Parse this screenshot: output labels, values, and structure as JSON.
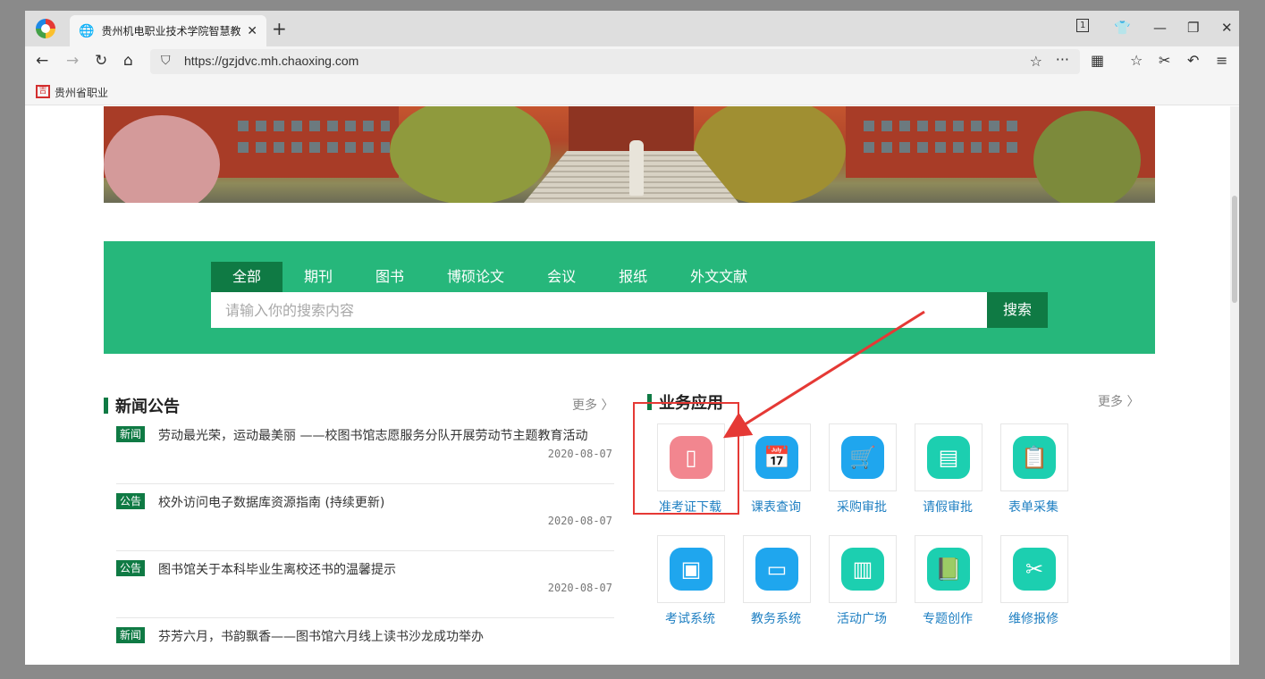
{
  "browser": {
    "tab_title": "贵州机电职业技术学院智慧教",
    "url": "https://gzjdvc.mh.chaoxing.com",
    "tab_count": "1",
    "bookmark": "贵州省职业"
  },
  "search": {
    "tabs": [
      "全部",
      "期刊",
      "图书",
      "博硕论文",
      "会议",
      "报纸",
      "外文文献"
    ],
    "placeholder": "请输入你的搜索内容",
    "button": "搜索"
  },
  "news": {
    "title": "新闻公告",
    "more": "更多 〉",
    "items": [
      {
        "badge": "新闻",
        "title": "劳动最光荣，运动最美丽 ——校图书馆志愿服务分队开展劳动节主题教育活动",
        "date": "2020-08-07"
      },
      {
        "badge": "公告",
        "title": "校外访问电子数据库资源指南 (持续更新)",
        "date": "2020-08-07"
      },
      {
        "badge": "公告",
        "title": "图书馆关于本科毕业生离校还书的温馨提示",
        "date": "2020-08-07"
      },
      {
        "badge": "新闻",
        "title": "芬芳六月，书韵飘香——图书馆六月线上读书沙龙成功举办",
        "date": ""
      }
    ]
  },
  "apps": {
    "title": "业务应用",
    "more": "更多 〉",
    "items": [
      {
        "label": "准考证下载",
        "icon": "id-card-icon",
        "color": "#f2868f"
      },
      {
        "label": "课表查询",
        "icon": "calendar-icon",
        "color": "#1fa6ee"
      },
      {
        "label": "采购审批",
        "icon": "cart-icon",
        "color": "#1fa6ee"
      },
      {
        "label": "请假审批",
        "icon": "leave-icon",
        "color": "#1ccfb0"
      },
      {
        "label": "表单采集",
        "icon": "form-icon",
        "color": "#1ccfb0"
      },
      {
        "label": "考试系统",
        "icon": "exam-icon",
        "color": "#1fa6ee"
      },
      {
        "label": "教务系统",
        "icon": "printer-icon",
        "color": "#1fa6ee"
      },
      {
        "label": "活动广场",
        "icon": "building-icon",
        "color": "#1ccfb0"
      },
      {
        "label": "专题创作",
        "icon": "book-icon",
        "color": "#1ccfb0"
      },
      {
        "label": "维修报修",
        "icon": "tools-icon",
        "color": "#1ccfb0"
      }
    ]
  },
  "colors": {
    "brand_green": "#26b77b",
    "dark_green": "#0f7a44",
    "annotation_red": "#e53935"
  }
}
